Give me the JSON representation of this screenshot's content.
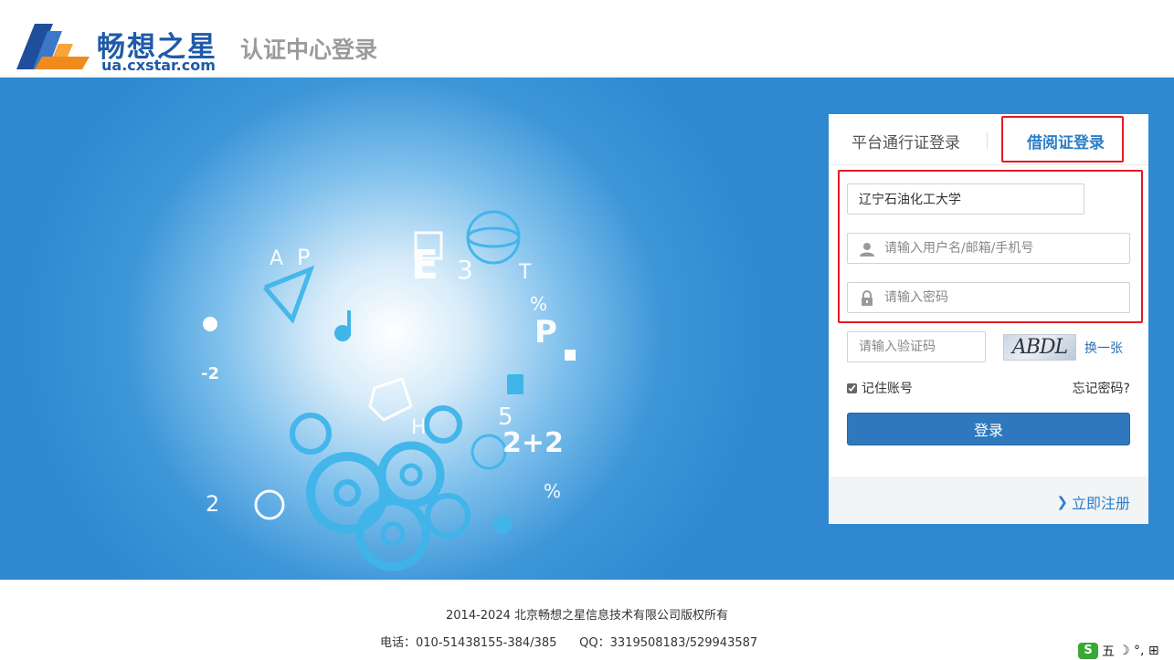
{
  "header": {
    "brand_name": "畅想之星",
    "brand_domain": "ua.cxstar.com",
    "title": "认证中心登录"
  },
  "login": {
    "tabs": [
      {
        "label": "平台通行证登录",
        "active": false
      },
      {
        "label": "借阅证登录",
        "active": true
      }
    ],
    "school_value": "辽宁石油化工大学",
    "username_placeholder": "请输入用户名/邮箱/手机号",
    "password_placeholder": "请输入密码",
    "captcha_placeholder": "请输入验证码",
    "captcha_text": "ABDL",
    "captcha_refresh": "换一张",
    "remember_label": "记住账号",
    "remember_checked": true,
    "forgot_label": "忘记密码?",
    "submit_label": "登录",
    "register_label": "立即注册"
  },
  "footer": {
    "copyright": "2014-2024 北京畅想之星信息技术有限公司版权所有",
    "contact": "电话：010-51438155-384/385      QQ：3319508183/529943587"
  },
  "ime": {
    "logo": "S",
    "mode": "五",
    "icons": "☽ °, ⊞"
  },
  "colors": {
    "brand_blue": "#1f5aa8",
    "accent": "#2c7ec7",
    "button": "#2f78bd",
    "highlight_red": "#e21b23",
    "banner": "#2f88d0"
  }
}
